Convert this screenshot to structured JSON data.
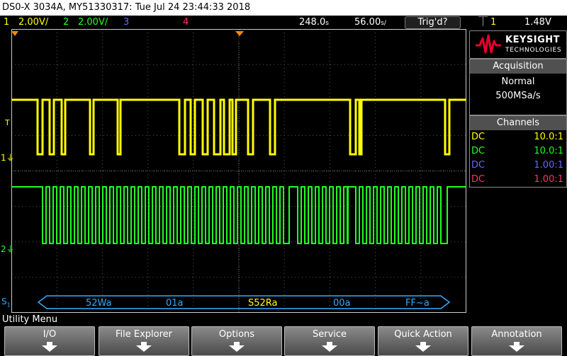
{
  "title_bar": {
    "text": "DS0-X 3034A, MY51330317: Tue Jul 24 23:44:33 2018"
  },
  "status": {
    "ch1_num": "1",
    "ch1_scale": "2.00V/",
    "ch2_num": "2",
    "ch2_scale": "2.00V/",
    "ch3_num": "3",
    "ch4_num": "4",
    "time_delay": "248.0",
    "time_delay_unit": "s",
    "time_scale": "56.00",
    "time_scale_unit": "s/",
    "trigger_status": "Trig'd?",
    "trig_channel": "1",
    "trig_level": "1.48V"
  },
  "brand": {
    "name": "KEYSIGHT",
    "sub": "TECHNOLOGIES"
  },
  "acquisition": {
    "header": "Acquisition",
    "mode": "Normal",
    "rate": "500MSa/s"
  },
  "channels_panel": {
    "header": "Channels",
    "rows": [
      {
        "coupling": "DC",
        "probe": "10.0:1",
        "color": "#ffff00"
      },
      {
        "coupling": "DC",
        "probe": "10.0:1",
        "color": "#22ff22"
      },
      {
        "coupling": "DC",
        "probe": "1.00:1",
        "color": "#6666ff"
      },
      {
        "coupling": "DC",
        "probe": "1.00:1",
        "color": "#ff3366"
      }
    ]
  },
  "markers": {
    "trigger_level": "T",
    "ch1": "1",
    "ch2": "2",
    "serial": "S",
    "serial_sub": "1"
  },
  "decode": {
    "segments": [
      "52Wa",
      "01a",
      "S52Ra",
      "00a",
      "FF~a"
    ]
  },
  "menu": {
    "title": "Utility Menu"
  },
  "softkeys": [
    "I/O",
    "File Explorer",
    "Options",
    "Service",
    "Quick Action",
    "Annotation"
  ],
  "colors": {
    "ch1": "#ffff00",
    "ch2": "#22ff22",
    "ch3": "#6666ff",
    "ch4": "#ff3366",
    "decode": "#33aaff",
    "bg": "#000000"
  }
}
